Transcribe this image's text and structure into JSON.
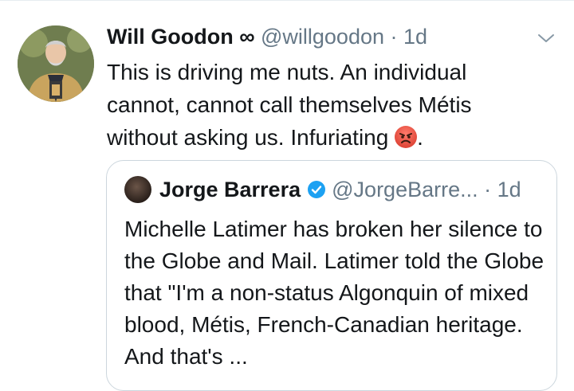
{
  "tweet": {
    "author_name": "Will Goodon",
    "author_badge": "∞",
    "handle": "@willgoodon",
    "separator": "·",
    "time": "1d",
    "text": "This is driving me nuts. An individual cannot, cannot call themselves Métis without asking us. Infuriating",
    "text_end": ".",
    "emoji": "pouting-face-emoji"
  },
  "quoted_tweet": {
    "author_name": "Jorge Barrera",
    "handle": "@JorgeBarre...",
    "separator": "·",
    "time": "1d",
    "text": "Michelle Latimer has broken her silence to the Globe and Mail. Latimer told the Globe that \"I'm a non-status Algonquin of mixed blood, Métis, French-Canadian heritage. And that's ..."
  },
  "colors": {
    "muted": "#657786",
    "border": "#ccd6dd",
    "verified": "#1da1f2"
  }
}
